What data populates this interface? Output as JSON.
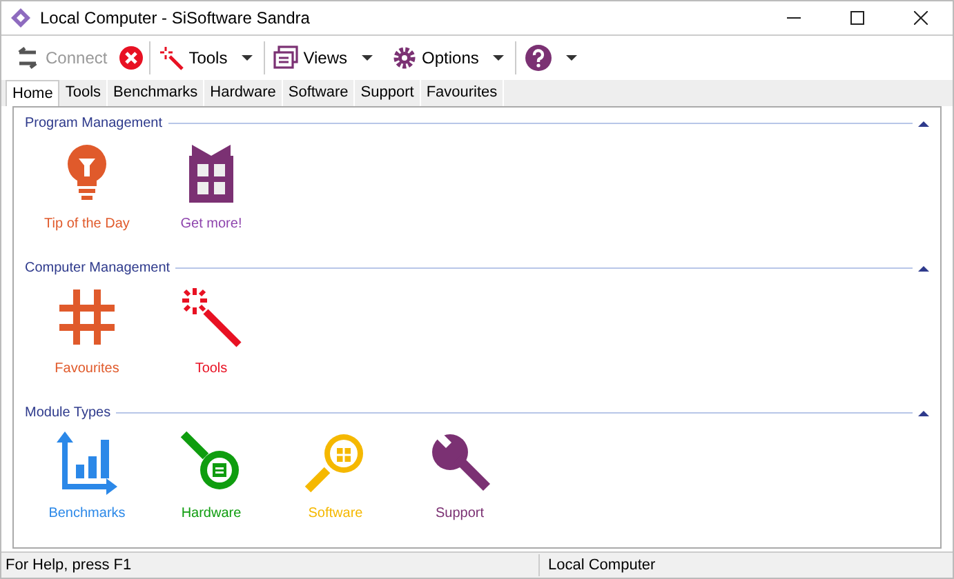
{
  "window": {
    "title": "Local Computer - SiSoftware Sandra"
  },
  "toolbar": [
    {
      "kind": "connect",
      "label": "Connect",
      "disabled": true
    },
    {
      "kind": "stop"
    },
    {
      "kind": "tools",
      "label": "Tools",
      "dropdown": true
    },
    {
      "kind": "views",
      "label": "Views",
      "dropdown": true
    },
    {
      "kind": "options",
      "label": "Options",
      "dropdown": true
    },
    {
      "kind": "help",
      "dropdown": true
    }
  ],
  "tabs": [
    {
      "label": "Home",
      "selected": true
    },
    {
      "label": "Tools",
      "selected": false
    },
    {
      "label": "Benchmarks",
      "selected": false
    },
    {
      "label": "Hardware",
      "selected": false
    },
    {
      "label": "Software",
      "selected": false
    },
    {
      "label": "Support",
      "selected": false
    },
    {
      "label": "Favourites",
      "selected": false
    }
  ],
  "sections": [
    {
      "title": "Program Management",
      "items": [
        {
          "kind": "tip",
          "label": "Tip of the Day",
          "color": "#e05a2b"
        },
        {
          "kind": "gift",
          "label": "Get more!",
          "color": "#8e44ad"
        }
      ]
    },
    {
      "title": "Computer Management",
      "items": [
        {
          "kind": "hash",
          "label": "Favourites",
          "color": "#e05a2b"
        },
        {
          "kind": "wand",
          "label": "Tools",
          "color": "#e81123"
        }
      ]
    },
    {
      "title": "Module Types",
      "items": [
        {
          "kind": "chart",
          "label": "Benchmarks",
          "color": "#2b88e8"
        },
        {
          "kind": "hardware",
          "label": "Hardware",
          "color": "#0f9d0f"
        },
        {
          "kind": "software",
          "label": "Software",
          "color": "#f5b800"
        },
        {
          "kind": "wrench",
          "label": "Support",
          "color": "#7b3173"
        }
      ]
    }
  ],
  "status_bar": {
    "left": "For Help, press F1",
    "middle": "Local Computer"
  }
}
